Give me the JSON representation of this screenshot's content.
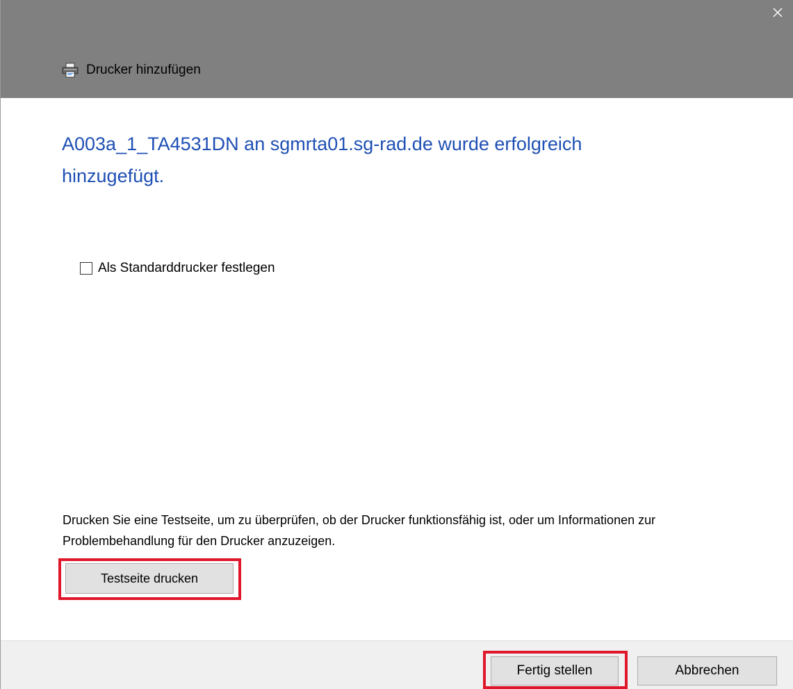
{
  "window": {
    "title": "Drucker hinzufügen",
    "title_icon": "printer-icon",
    "close_icon": "close-icon"
  },
  "content": {
    "heading": "A003a_1_TA4531DN an sgmrta01.sg-rad.de wurde erfolgreich hinzugefügt.",
    "default_printer_checkbox": {
      "label": "Als Standarddrucker festlegen",
      "checked": false
    },
    "info_text": "Drucken Sie eine Testseite, um zu überprüfen, ob der Drucker funktionsfähig ist, oder um Informationen zur Problembehandlung für den Drucker anzuzeigen.",
    "test_page_button": "Testseite drucken"
  },
  "footer": {
    "finish_button": "Fertig stellen",
    "cancel_button": "Abbrechen"
  },
  "colors": {
    "titlebar": "#808080",
    "heading": "#1e4fb4",
    "highlight": "#e0162b",
    "button": "#e1e1e1",
    "footer": "#f0f0f0"
  }
}
